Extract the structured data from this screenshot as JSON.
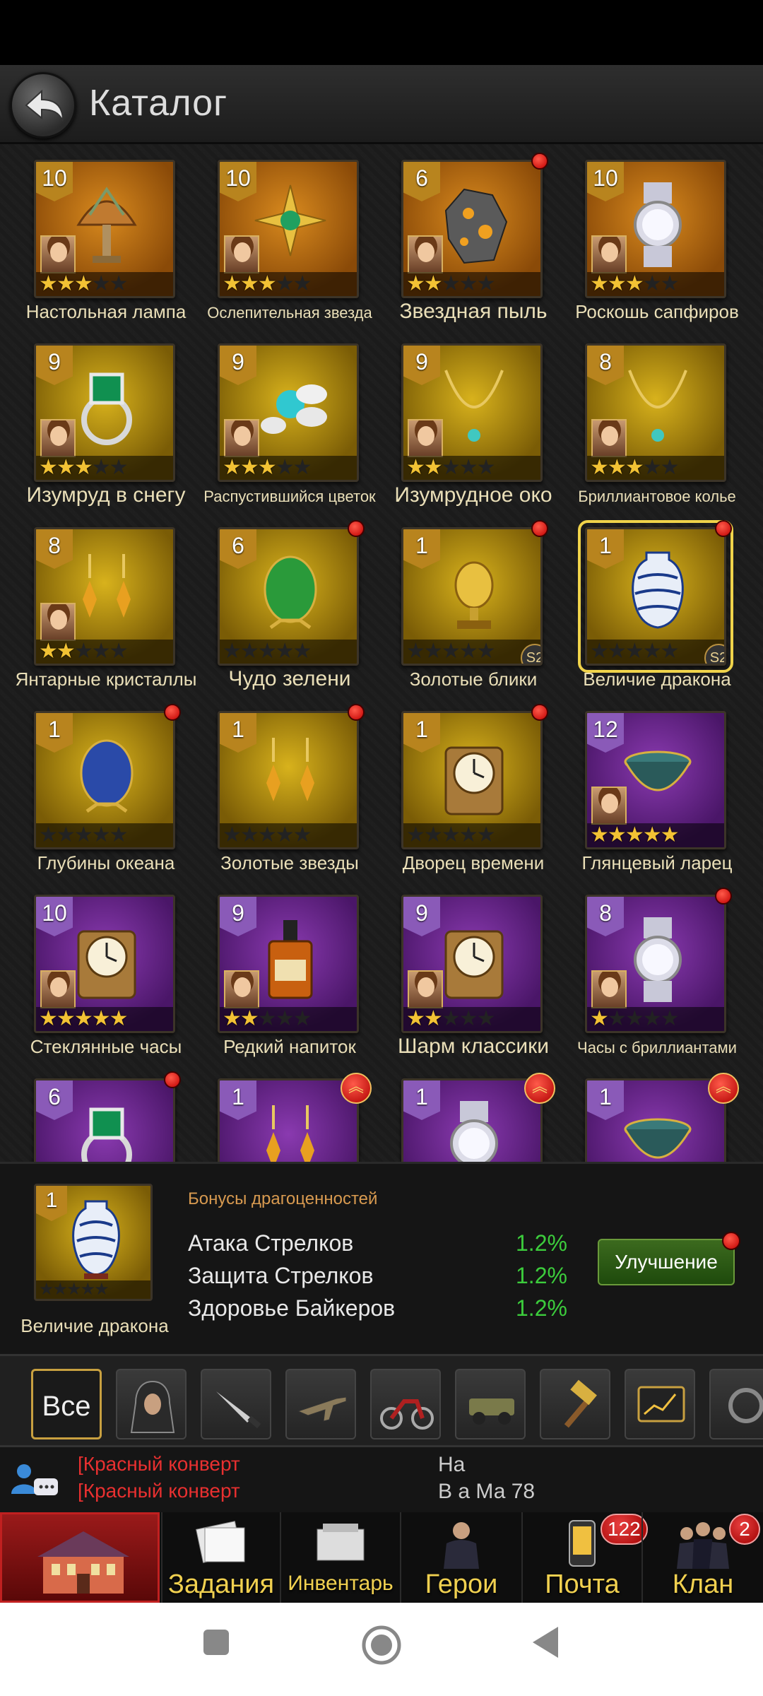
{
  "header": {
    "title": "Каталог"
  },
  "grid": {
    "items": [
      {
        "name": "Настольная лампа",
        "level": "10",
        "bg": "orange",
        "stars": 3,
        "portrait": true,
        "dot": false,
        "label_size": "normal",
        "art": "lamp"
      },
      {
        "name": "Ослепительная звезда",
        "level": "10",
        "bg": "orange",
        "stars": 3,
        "portrait": true,
        "dot": false,
        "label_size": "small",
        "art": "star"
      },
      {
        "name": "Звездная пыль",
        "level": "6",
        "bg": "orange",
        "stars": 2,
        "portrait": true,
        "dot": true,
        "label_size": "large",
        "art": "rock"
      },
      {
        "name": "Роскошь сапфиров",
        "level": "10",
        "bg": "orange",
        "stars": 3,
        "portrait": true,
        "dot": false,
        "label_size": "normal",
        "art": "watch"
      },
      {
        "name": "Изумруд в снегу",
        "level": "9",
        "bg": "gold",
        "stars": 3,
        "portrait": true,
        "dot": false,
        "label_size": "large",
        "art": "ring"
      },
      {
        "name": "Распустившийся цветок",
        "level": "9",
        "bg": "gold",
        "stars": 3,
        "portrait": true,
        "dot": false,
        "label_size": "small",
        "art": "flower"
      },
      {
        "name": "Изумрудное око",
        "level": "9",
        "bg": "gold",
        "stars": 2,
        "portrait": true,
        "dot": false,
        "label_size": "large",
        "art": "necklace"
      },
      {
        "name": "Бриллиантовое колье",
        "level": "8",
        "bg": "gold",
        "stars": 3,
        "portrait": true,
        "dot": false,
        "label_size": "small",
        "art": "necklace"
      },
      {
        "name": "Янтарные кристаллы",
        "level": "8",
        "bg": "gold",
        "stars": 2,
        "portrait": true,
        "dot": false,
        "label_size": "normal",
        "art": "earrings"
      },
      {
        "name": "Чудо зелени",
        "level": "6",
        "bg": "gold",
        "stars": 0,
        "portrait": false,
        "dot": true,
        "label_size": "large",
        "art": "egg-green"
      },
      {
        "name": "Золотые блики",
        "level": "1",
        "bg": "gold",
        "stars": 0,
        "portrait": false,
        "dot": true,
        "label_size": "normal",
        "art": "trophy",
        "s2": "S2"
      },
      {
        "name": "Величие дракона",
        "level": "1",
        "bg": "gold",
        "stars": 0,
        "portrait": false,
        "dot": true,
        "label_size": "normal",
        "art": "vase",
        "s2": "S2",
        "selected": true
      },
      {
        "name": "Глубины океана",
        "level": "1",
        "bg": "gold",
        "stars": 0,
        "portrait": false,
        "dot": true,
        "label_size": "normal",
        "art": "egg-blue"
      },
      {
        "name": "Золотые звезды",
        "level": "1",
        "bg": "gold",
        "stars": 0,
        "portrait": false,
        "dot": true,
        "label_size": "normal",
        "art": "earrings"
      },
      {
        "name": "Дворец времени",
        "level": "1",
        "bg": "gold",
        "stars": 0,
        "portrait": false,
        "dot": true,
        "label_size": "normal",
        "art": "clock"
      },
      {
        "name": "Глянцевый ларец",
        "level": "12",
        "bg": "purple",
        "stars": 5,
        "portrait": true,
        "dot": false,
        "label_size": "normal",
        "art": "bowl"
      },
      {
        "name": "Стеклянные часы",
        "level": "10",
        "bg": "purple",
        "stars": 5,
        "portrait": true,
        "dot": false,
        "label_size": "normal",
        "art": "clock"
      },
      {
        "name": "Редкий напиток",
        "level": "9",
        "bg": "purple",
        "stars": 2,
        "portrait": true,
        "dot": false,
        "label_size": "normal",
        "art": "bottle"
      },
      {
        "name": "Шарм классики",
        "level": "9",
        "bg": "purple",
        "stars": 2,
        "portrait": true,
        "dot": false,
        "label_size": "large",
        "art": "clock"
      },
      {
        "name": "Часы с бриллиантами",
        "level": "8",
        "bg": "purple",
        "stars": 1,
        "portrait": true,
        "dot": true,
        "label_size": "small",
        "art": "watch"
      },
      {
        "name": "",
        "level": "6",
        "bg": "purple",
        "stars": 0,
        "portrait": false,
        "dot": true,
        "label_size": "normal",
        "art": "ring"
      },
      {
        "name": "",
        "level": "1",
        "bg": "purple",
        "stars": 0,
        "portrait": false,
        "dot": false,
        "up": "︽",
        "label_size": "normal",
        "art": "earrings"
      },
      {
        "name": "",
        "level": "1",
        "bg": "purple",
        "stars": 0,
        "portrait": false,
        "dot": false,
        "up": "︽",
        "label_size": "normal",
        "art": "watch"
      },
      {
        "name": "",
        "level": "1",
        "bg": "purple",
        "stars": 0,
        "portrait": false,
        "dot": false,
        "up": "︽",
        "label_size": "normal",
        "art": "bowl"
      }
    ]
  },
  "bonus": {
    "item_level": "1",
    "item_name": "Величие дракона",
    "title": "Бонусы драгоценностей",
    "rows": [
      {
        "label": "Атака Стрелков",
        "value": "1.2%"
      },
      {
        "label": "Защита Стрелков",
        "value": "1.2%"
      },
      {
        "label": "Здоровье Байкеров",
        "value": "1.2%"
      }
    ],
    "upgrade_label": "Улучшение"
  },
  "filters": {
    "all_label": "Все",
    "icons": [
      "hooded-figure-icon",
      "knife-icon",
      "rifle-icon",
      "motorcycle-icon",
      "jeep-icon",
      "hammer-icon",
      "tablet-icon",
      "gear-partial-icon"
    ]
  },
  "chat": {
    "line1": "[Красный конверт",
    "line2": "[Красный конверт",
    "right1": "На",
    "right2": "В        а Ма      78"
  },
  "bottom_nav": {
    "items": [
      {
        "label": "Задания",
        "badge": ""
      },
      {
        "label": "Инвентарь",
        "badge": ""
      },
      {
        "label": "Герои",
        "badge": ""
      },
      {
        "label": "Почта",
        "badge": "122"
      },
      {
        "label": "Клан",
        "badge": "2"
      }
    ]
  },
  "colors": {
    "accent_gold": "#f0d050",
    "bonus_green": "#3ccc3c",
    "alert_red": "#e83030",
    "bonus_title": "#d89a50"
  }
}
